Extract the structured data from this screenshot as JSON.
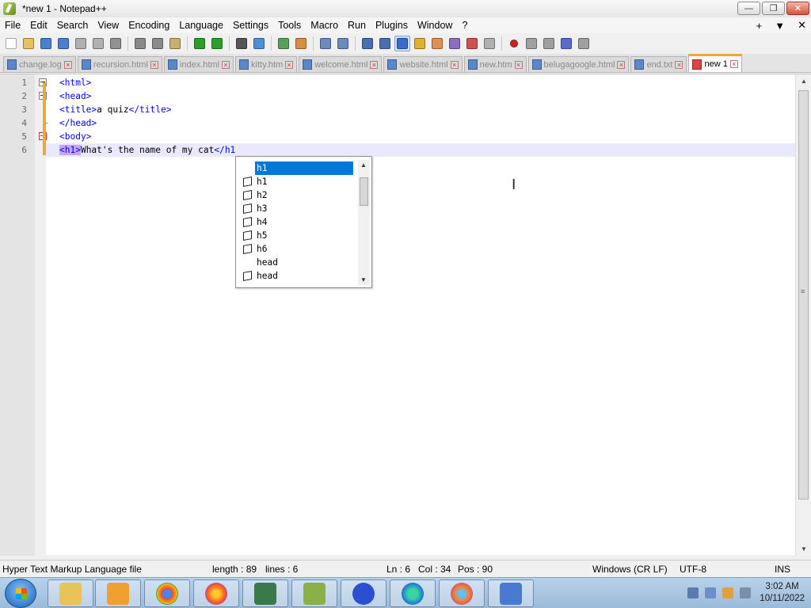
{
  "window": {
    "title": "*new 1 - Notepad++"
  },
  "menu": {
    "items": [
      "File",
      "Edit",
      "Search",
      "View",
      "Encoding",
      "Language",
      "Settings",
      "Tools",
      "Macro",
      "Run",
      "Plugins",
      "Window",
      "?"
    ],
    "right": [
      "+",
      "▼",
      "✕"
    ]
  },
  "toolbar": {
    "icons": [
      "new-file-icon",
      "open-file-icon",
      "save-icon",
      "save-all-icon",
      "close-icon",
      "close-all-icon",
      "print-icon",
      "cut-icon",
      "copy-icon",
      "paste-icon",
      "undo-icon",
      "redo-icon",
      "find-icon",
      "replace-icon",
      "zoom-in-icon",
      "zoom-out-icon",
      "sync-v-icon",
      "sync-h-icon",
      "word-wrap-icon",
      "show-all-chars-icon",
      "indent-guide-icon",
      "udl-icon",
      "doc-map-icon",
      "function-list-icon",
      "folder-workspace-icon",
      "monitoring-icon",
      "record-macro-icon",
      "stop-macro-icon",
      "play-macro-icon",
      "run-macro-multiple-icon",
      "save-macro-icon"
    ]
  },
  "tabs": [
    {
      "label": "change.log",
      "active": false
    },
    {
      "label": "recursion.html",
      "active": false
    },
    {
      "label": "index.html",
      "active": false
    },
    {
      "label": "kitty.htm",
      "active": false
    },
    {
      "label": "welcome.html",
      "active": false
    },
    {
      "label": "website.html",
      "active": false
    },
    {
      "label": "new.htm",
      "active": false
    },
    {
      "label": "belugagoogle.html",
      "active": false
    },
    {
      "label": "end.txt",
      "active": false
    },
    {
      "label": "new 1",
      "active": true
    }
  ],
  "editor": {
    "line_numbers": [
      "1",
      "2",
      "3",
      "4",
      "5",
      "6"
    ],
    "lines": [
      {
        "tag_open": "<html>",
        "text": "",
        "tag_close": ""
      },
      {
        "tag_open": "<head>",
        "text": "",
        "tag_close": ""
      },
      {
        "tag_open": "<title>",
        "text": "a quiz",
        "tag_close": "</title>"
      },
      {
        "tag_open": "</head>",
        "text": "",
        "tag_close": ""
      },
      {
        "tag_open": "<body>",
        "text": "",
        "tag_close": ""
      },
      {
        "tag_open": "<h1>",
        "text": "What's the name of my cat",
        "tag_close": "</h1"
      }
    ]
  },
  "autocomplete": {
    "items": [
      {
        "label": "h1",
        "icon": false,
        "selected": true
      },
      {
        "label": "h1",
        "icon": true,
        "selected": false
      },
      {
        "label": "h2",
        "icon": true,
        "selected": false
      },
      {
        "label": "h3",
        "icon": true,
        "selected": false
      },
      {
        "label": "h4",
        "icon": true,
        "selected": false
      },
      {
        "label": "h5",
        "icon": true,
        "selected": false
      },
      {
        "label": "h6",
        "icon": true,
        "selected": false
      },
      {
        "label": "head",
        "icon": false,
        "selected": false
      },
      {
        "label": "head",
        "icon": true,
        "selected": false
      }
    ]
  },
  "status": {
    "file_type": "Hyper Text Markup Language file",
    "length": "length : 89",
    "lines": "lines : 6",
    "ln": "Ln : 6",
    "col": "Col : 34",
    "pos": "Pos : 90",
    "eol": "Windows (CR LF)",
    "encoding": "UTF-8",
    "mode": "INS"
  },
  "taskbar": {
    "apps": [
      "file-explorer-icon",
      "media-player-icon",
      "chrome-icon",
      "firefox-icon",
      "network-tool-icon",
      "notepadpp-icon",
      "malwarebytes-icon",
      "edge-icon",
      "firefox-dev-icon",
      "control-panel-icon"
    ],
    "time": "3:02 AM",
    "date": "10/11/2022"
  },
  "colors": {
    "tag": "#0000ff",
    "tag_highlight": "#c9a7f0",
    "selection": "#0078d7",
    "changebar": "#f6a534",
    "current_line": "#e8e8ff"
  }
}
